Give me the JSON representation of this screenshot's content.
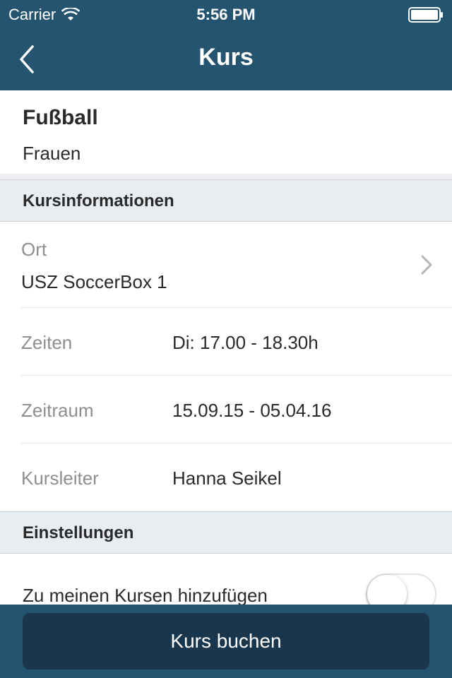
{
  "status_bar": {
    "carrier": "Carrier",
    "time": "5:56 PM"
  },
  "nav": {
    "title": "Kurs",
    "back_icon": "chevron-left-icon"
  },
  "course": {
    "title": "Fußball",
    "subtitle": "Frauen"
  },
  "sections": {
    "info": "Kursinformationen",
    "settings": "Einstellungen"
  },
  "info_rows": {
    "ort": {
      "label": "Ort",
      "value": "USZ SoccerBox 1"
    },
    "zeiten": {
      "label": "Zeiten",
      "value": "Di: 17.00 - 18.30h"
    },
    "zeitraum": {
      "label": "Zeitraum",
      "value": "15.09.15 - 05.04.16"
    },
    "kursleiter": {
      "label": "Kursleiter",
      "value": "Hanna Seikel"
    }
  },
  "settings_rows": {
    "add_to_courses": {
      "label": "Zu meinen Kursen hinzufügen",
      "enabled": false
    }
  },
  "footer": {
    "book_label": "Kurs buchen"
  },
  "colors": {
    "brand": "#255470",
    "button": "#19364d",
    "section_bg": "#e8edf2"
  }
}
